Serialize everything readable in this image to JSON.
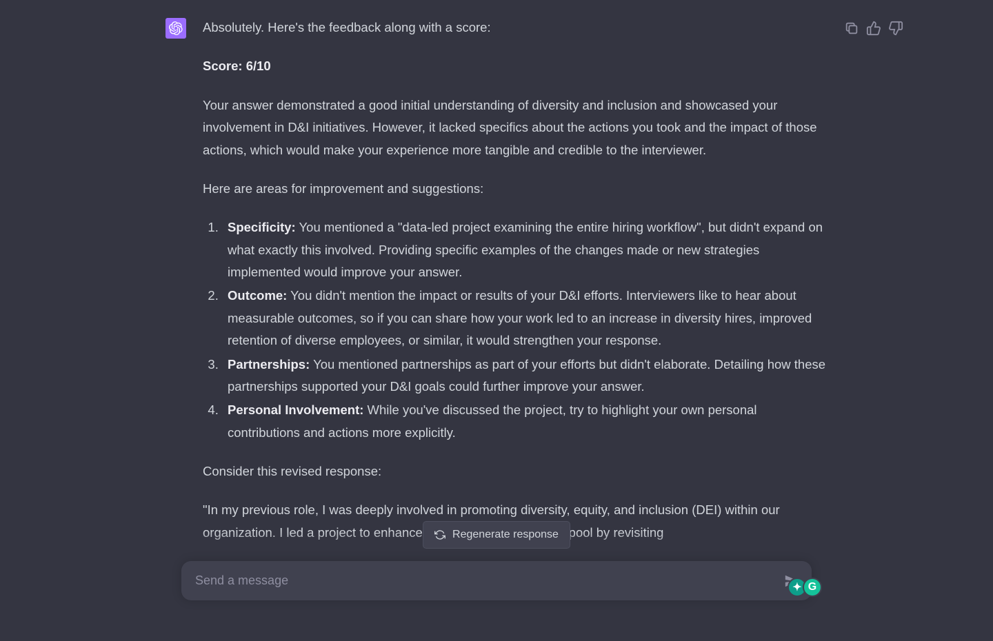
{
  "assistant": {
    "intro": "Absolutely. Here's the feedback along with a score:",
    "score_label": "Score: 6/10",
    "paragraph1": "Your answer demonstrated a good initial understanding of diversity and inclusion and showcased your involvement in D&I initiatives. However, it lacked specifics about the actions you took and the impact of those actions, which would make your experience more tangible and credible to the interviewer.",
    "improvement_intro": "Here are areas for improvement and suggestions:",
    "items": [
      {
        "label": "Specificity:",
        "text": " You mentioned a \"data-led project examining the entire hiring workflow\", but didn't expand on what exactly this involved. Providing specific examples of the changes made or new strategies implemented would improve your answer."
      },
      {
        "label": "Outcome:",
        "text": " You didn't mention the impact or results of your D&I efforts. Interviewers like to hear about measurable outcomes, so if you can share how your work led to an increase in diversity hires, improved retention of diverse employees, or similar, it would strengthen your response."
      },
      {
        "label": "Partnerships:",
        "text": " You mentioned partnerships as part of your efforts but didn't elaborate. Detailing how these partnerships supported your D&I goals could further improve your answer."
      },
      {
        "label": "Personal Involvement:",
        "text": " While you've discussed the project, try to highlight your own personal contributions and actions more explicitly."
      }
    ],
    "consider": "Consider this revised response:",
    "revised": "\"In my previous role, I was deeply involved in promoting diversity, equity, and inclusion (DEI) within our organization. I led a project to enhance the diversity of our talent pool by revisiting"
  },
  "regenerate_label": "Regenerate response",
  "input": {
    "placeholder": "Send a message"
  },
  "grammarly": {
    "letter": "G",
    "plus": "✦"
  }
}
